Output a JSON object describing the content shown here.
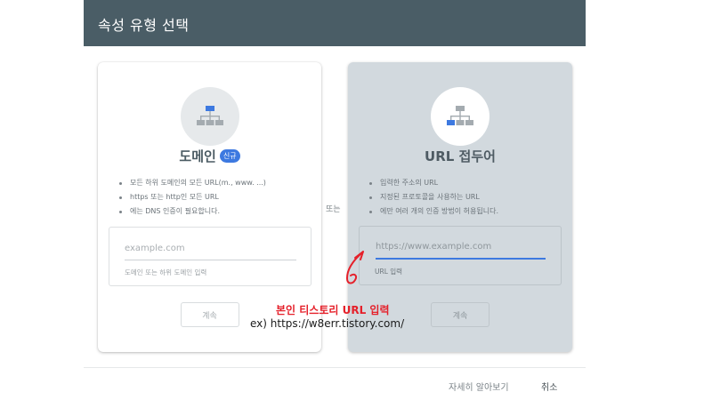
{
  "dialog": {
    "title": "속성 유형 선택"
  },
  "domain_card": {
    "heading": "도메인",
    "badge": "신규",
    "bullets": [
      "모든 하위 도메인의 모든 URL(m., www. ...)",
      "https 또는 http인 모든 URL",
      "에는 DNS 인증이 필요합니다."
    ],
    "input_placeholder": "example.com",
    "input_value": "",
    "hint": "도메인 또는 하위 도메인 입력",
    "continue_label": "계속",
    "icon": "sitemap-icon"
  },
  "or_label": "또는",
  "prefix_card": {
    "heading": "URL 접두어",
    "bullets": [
      "입력한 주소의 URL",
      "지정된 프로토콜을 사용하는 URL",
      "에만 여러 개의 인증 방법이 허용됩니다."
    ],
    "input_placeholder": "https://www.example.com",
    "input_value": "",
    "hint": "URL 입력",
    "continue_label": "계속",
    "icon": "sitemap-icon"
  },
  "annotation": {
    "line1": "본인 티스토리 URL 입력",
    "line2": "ex) https://w8err.tistory.com/",
    "color": "#e5202a"
  },
  "footer": {
    "learn_more": "자세히 알아보기",
    "cancel": "취소"
  },
  "colors": {
    "title_bar": "#4a5d66",
    "accent": "#3d79e0",
    "selected_card": "#d2d9de"
  }
}
